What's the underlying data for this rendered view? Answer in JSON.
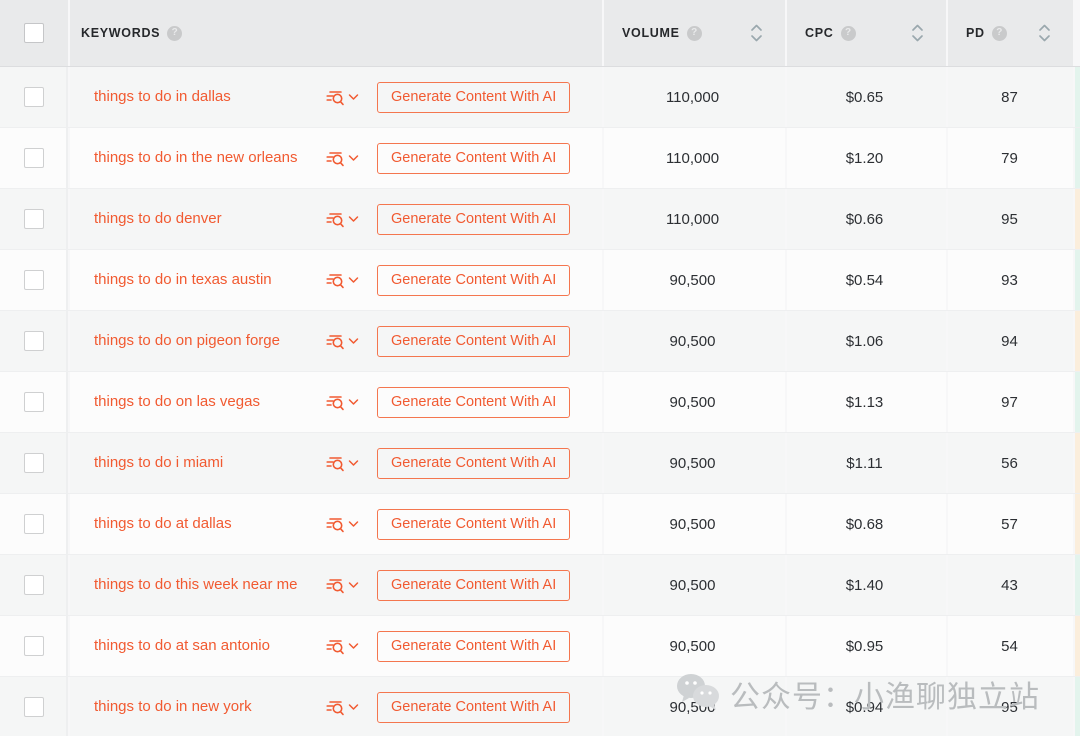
{
  "header": {
    "select_all_checkbox": "unchecked",
    "columns": [
      {
        "id": "keywords",
        "label": "KEYWORDS",
        "help": "?",
        "sortable": false
      },
      {
        "id": "volume",
        "label": "VOLUME",
        "help": "?",
        "sortable": true
      },
      {
        "id": "cpc",
        "label": "CPC",
        "help": "?",
        "sortable": true
      },
      {
        "id": "pd",
        "label": "PD",
        "help": "?",
        "sortable": true
      }
    ]
  },
  "actions": {
    "generate_label": "Generate Content With AI",
    "serp_icon_name": "serp-analysis-icon",
    "chevron_icon_name": "chevron-down-icon"
  },
  "colors": {
    "accent": "#f15a31",
    "header_bg": "#e9eaeb",
    "row_bg": "#fcfcfc",
    "row_alt_bg": "#f5f6f6",
    "sliver_green": "#e3f4ed",
    "sliver_orange": "#fbeedc",
    "text": "#2c2f33",
    "sort_icon": "#9aa8ad"
  },
  "rows": [
    {
      "keyword": "things to do in dallas",
      "volume": "110,000",
      "cpc": "$0.65",
      "pd": "87",
      "sliver": "green"
    },
    {
      "keyword": "things to do in the new orleans",
      "volume": "110,000",
      "cpc": "$1.20",
      "pd": "79",
      "sliver": "green"
    },
    {
      "keyword": "things to do denver",
      "volume": "110,000",
      "cpc": "$0.66",
      "pd": "95",
      "sliver": "orange"
    },
    {
      "keyword": "things to do in texas austin",
      "volume": "90,500",
      "cpc": "$0.54",
      "pd": "93",
      "sliver": "green"
    },
    {
      "keyword": "things to do on pigeon forge",
      "volume": "90,500",
      "cpc": "$1.06",
      "pd": "94",
      "sliver": "orange"
    },
    {
      "keyword": "things to do on las vegas",
      "volume": "90,500",
      "cpc": "$1.13",
      "pd": "97",
      "sliver": "green"
    },
    {
      "keyword": "things to do i miami",
      "volume": "90,500",
      "cpc": "$1.11",
      "pd": "56",
      "sliver": "orange"
    },
    {
      "keyword": "things to do at dallas",
      "volume": "90,500",
      "cpc": "$0.68",
      "pd": "57",
      "sliver": "orange"
    },
    {
      "keyword": "things to do this week near me",
      "volume": "90,500",
      "cpc": "$1.40",
      "pd": "43",
      "sliver": "green"
    },
    {
      "keyword": "things to do at san antonio",
      "volume": "90,500",
      "cpc": "$0.95",
      "pd": "54",
      "sliver": "orange"
    },
    {
      "keyword": "things to do in new york",
      "volume": "90,500",
      "cpc": "$0.94",
      "pd": "95",
      "sliver": "green"
    }
  ],
  "watermark": {
    "text": "公众号：小渔聊独立站",
    "logo_name": "wechat-logo"
  }
}
